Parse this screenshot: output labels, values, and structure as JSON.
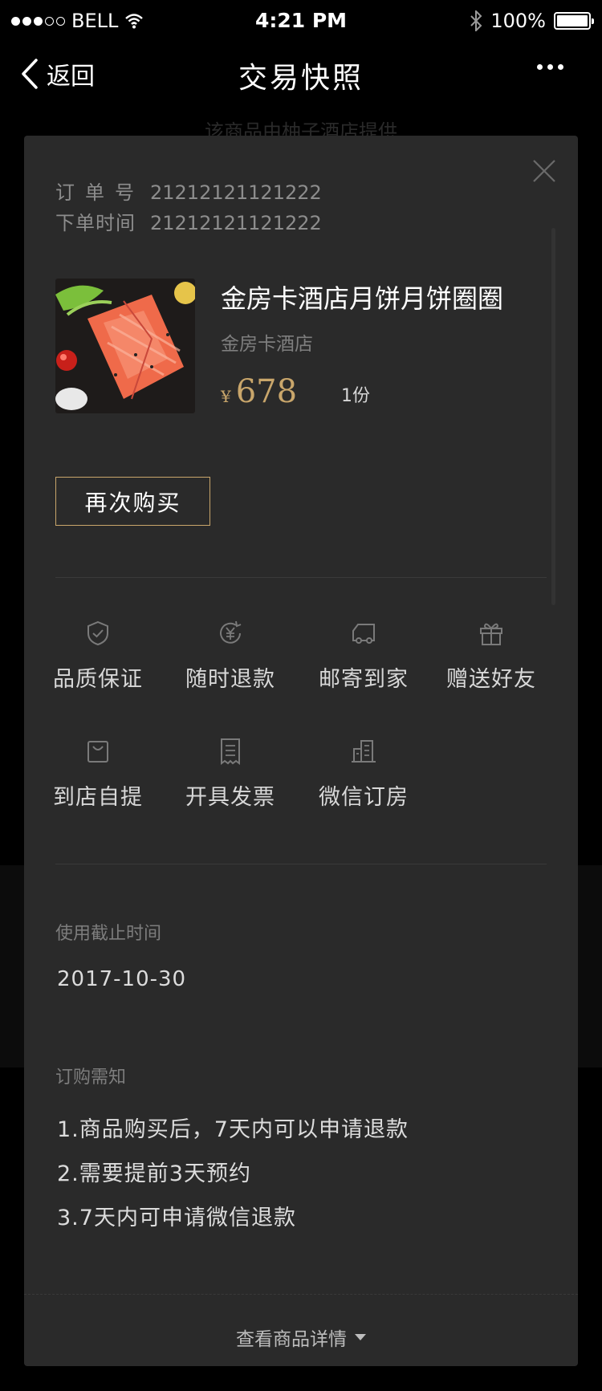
{
  "status_bar": {
    "carrier": "BELL",
    "time": "4:21 PM",
    "battery": "100%"
  },
  "nav": {
    "back_label": "返回",
    "title": "交易快照"
  },
  "background": {
    "provider_text": "该商品由柚子酒店提供"
  },
  "order": {
    "number_label": "订单号",
    "number_value": "21212121121222",
    "time_label": "下单时间",
    "time_value": "21212121121222"
  },
  "product": {
    "name": "金房卡酒店月饼月饼圈圈",
    "shop": "金房卡酒店",
    "currency": "¥",
    "price": "678",
    "quantity": "1份"
  },
  "buy_again_label": "再次购买",
  "services": [
    {
      "label": "品质保证",
      "icon": "shield-check-icon"
    },
    {
      "label": "随时退款",
      "icon": "yen-refresh-icon"
    },
    {
      "label": "邮寄到家",
      "icon": "truck-icon"
    },
    {
      "label": "赠送好友",
      "icon": "gift-icon"
    },
    {
      "label": "到店自提",
      "icon": "bag-icon"
    },
    {
      "label": "开具发票",
      "icon": "receipt-icon"
    },
    {
      "label": "微信订房",
      "icon": "building-icon"
    }
  ],
  "expiry": {
    "label": "使用截止时间",
    "value": "2017-10-30"
  },
  "notice": {
    "label": "订购需知",
    "items": [
      "1.商品购买后，7天内可以申请退款",
      "2.需要提前3天预约",
      "3.7天内可申请微信退款"
    ]
  },
  "view_details_label": "查看商品详情",
  "colors": {
    "accent_gold": "#c9a66b",
    "card_bg": "#2a2a2a",
    "page_bg": "#000000"
  }
}
